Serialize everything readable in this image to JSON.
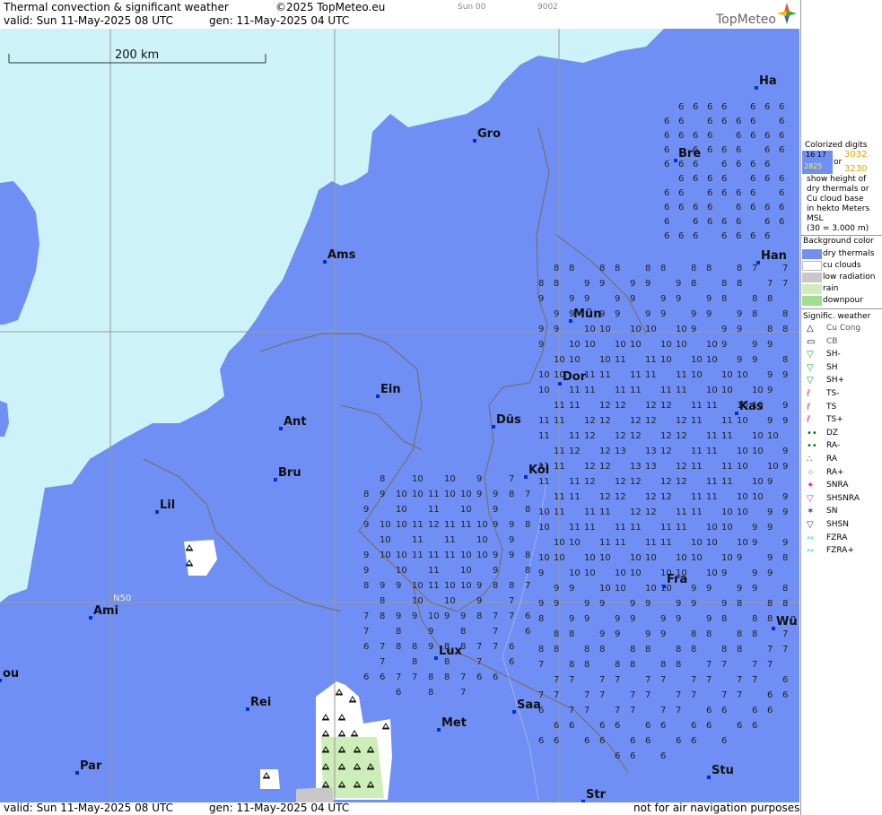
{
  "header": {
    "title": "Thermal convection & significant weather",
    "copyright": "©2025 TopMeteo.eu",
    "run_label": "Sun 00",
    "code": "9002",
    "valid": "valid:  Sun  11-May-2025  08 UTC",
    "gen": "gen: 11-May-2025 04 UTC",
    "logo": "TopMeteo"
  },
  "footer": {
    "valid": "valid:  Sun  11-May-2025  08 UTC",
    "gen": "gen: 11-May-2025 04 UTC",
    "disclaimer": "not for air navigation purposes"
  },
  "map": {
    "scale_label": "200 km",
    "lat_label": "N50",
    "colors": {
      "sea": "#cdf3f9",
      "dry_thermals": "#6f8ff5",
      "cu_clouds": "#ffffff",
      "low_radiation": "#c8c8c8",
      "rain": "#cdeeb8",
      "downpour": "#9ee090"
    },
    "cities": [
      "Ha",
      "Gro",
      "Bre",
      "Ams",
      "Han",
      "Mün",
      "Dor",
      "Ein",
      "Kas",
      "Ant",
      "Düs",
      "Bru",
      "Köl",
      "Lil",
      "Fra",
      "Ami",
      "Wü",
      "Lux",
      "ou",
      "Rei",
      "Saa",
      "Met",
      "Par",
      "Stu",
      "Str"
    ]
  },
  "legend": {
    "colorized_title": "Colorized digits",
    "sample_a": "16 17",
    "sample_b": "2825",
    "sample_or": "or",
    "sample_c": "3032",
    "sample_d": "3230",
    "desc": [
      "show height of",
      "dry thermals or",
      "Cu cloud base",
      "in hekto Meters",
      "MSL",
      "(30 = 3.000 m)"
    ],
    "bg_title": "Background color",
    "bg_items": [
      "dry thermals",
      "cu clouds",
      "low radiation",
      "rain",
      "downpour"
    ],
    "sig_title": "Signific. weather",
    "sig_items": [
      "Cu Cong",
      "CB",
      "SH-",
      "SH",
      "SH+",
      "TS-",
      "TS",
      "TS+",
      "DZ",
      "RA-",
      "RA",
      "RA+",
      "SNRA",
      "SHSNRA",
      "SN",
      "SHSN",
      "FZRA",
      "FZRA+"
    ]
  }
}
